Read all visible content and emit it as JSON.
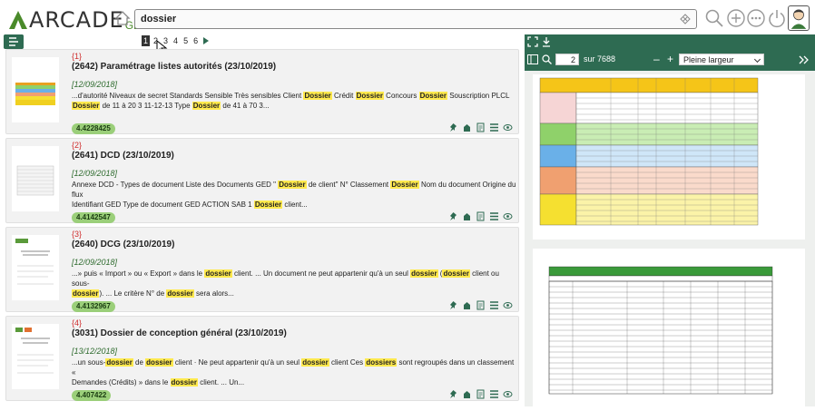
{
  "header": {
    "logo_text": "ARCADE",
    "logo_suffix": "GED",
    "search_value": "dossier"
  },
  "pager": {
    "pages": [
      "1",
      "2",
      "3",
      "4",
      "5",
      "6"
    ],
    "active": "1",
    "tooltip": "2"
  },
  "results": [
    {
      "num": "{1}",
      "title": "(2642) Paramétrage listes autorités (23/10/2019)",
      "date": "[12/09/2018]",
      "line1": [
        {
          "t": "...d'autorité Niveaux de secret Standards Sensible Très sensibles Client ",
          "h": false
        },
        {
          "t": "Dossier",
          "h": true
        },
        {
          "t": " Crédit ",
          "h": false
        },
        {
          "t": "Dossier",
          "h": true
        },
        {
          "t": " Concours ",
          "h": false
        },
        {
          "t": "Dossier",
          "h": true
        },
        {
          "t": " Souscription PLCL",
          "h": false
        }
      ],
      "line2": [
        {
          "t": "Dossier",
          "h": true
        },
        {
          "t": " de 11 à 20 3 11-12-13 Type ",
          "h": false
        },
        {
          "t": "Dossier",
          "h": true
        },
        {
          "t": " de 41 à 70 3...",
          "h": false
        }
      ],
      "score": "4.4228425"
    },
    {
      "num": "{2}",
      "title": "(2641) DCD (23/10/2019)",
      "date": "[12/09/2018]",
      "line1": [
        {
          "t": "Annexe DCD - Types de document Liste des Documents GED \" ",
          "h": false
        },
        {
          "t": "Dossier",
          "h": true
        },
        {
          "t": " de client\" N° Classement ",
          "h": false
        },
        {
          "t": "Dossier",
          "h": true
        },
        {
          "t": " Nom du document Origine du flux",
          "h": false
        }
      ],
      "line2": [
        {
          "t": "Identifiant GED Type de document GED ACTION SAB 1 ",
          "h": false
        },
        {
          "t": "Dossier",
          "h": true
        },
        {
          "t": " client...",
          "h": false
        }
      ],
      "score": "4.4142547"
    },
    {
      "num": "{3}",
      "title": "(2640) DCG (23/10/2019)",
      "date": "[12/09/2018]",
      "line1": [
        {
          "t": "...» puis « Import » ou « Export » dans le ",
          "h": false
        },
        {
          "t": "dossier",
          "h": true
        },
        {
          "t": " client. ... Un document ne peut appartenir qu'à un seul ",
          "h": false
        },
        {
          "t": "dossier",
          "h": true
        },
        {
          "t": " (",
          "h": false
        },
        {
          "t": "dossier",
          "h": true
        },
        {
          "t": " client ou sous-",
          "h": false
        }
      ],
      "line2": [
        {
          "t": "dossier",
          "h": true
        },
        {
          "t": "). ... Le critère N° de ",
          "h": false
        },
        {
          "t": "dossier",
          "h": true
        },
        {
          "t": " sera alors...",
          "h": false
        }
      ],
      "score": "4.4132967"
    },
    {
      "num": "{4}",
      "title": "(3031) Dossier de conception général (23/10/2019)",
      "date": "[13/12/2018]",
      "line1": [
        {
          "t": "...un sous-",
          "h": false
        },
        {
          "t": "dossier",
          "h": true
        },
        {
          "t": " de ",
          "h": false
        },
        {
          "t": "dossier",
          "h": true
        },
        {
          "t": " client · Ne peut appartenir qu'à un seul ",
          "h": false
        },
        {
          "t": "dossier",
          "h": true
        },
        {
          "t": " client Ces ",
          "h": false
        },
        {
          "t": "dossiers",
          "h": true
        },
        {
          "t": " sont regroupés dans un classement «",
          "h": false
        }
      ],
      "line2": [
        {
          "t": "Demandes (Crédits) » dans le ",
          "h": false
        },
        {
          "t": "dossier",
          "h": true
        },
        {
          "t": " client. ... Un...",
          "h": false
        }
      ],
      "score": "4.407422"
    }
  ],
  "viewer": {
    "page_value": "2",
    "page_total": "sur 7688",
    "zoom_value": "Pleine largeur"
  },
  "colors": {
    "brand_green": "#2e6b52",
    "score_green": "#9bcf7a",
    "highlight": "#ffe94d",
    "number_red": "#d03030"
  }
}
